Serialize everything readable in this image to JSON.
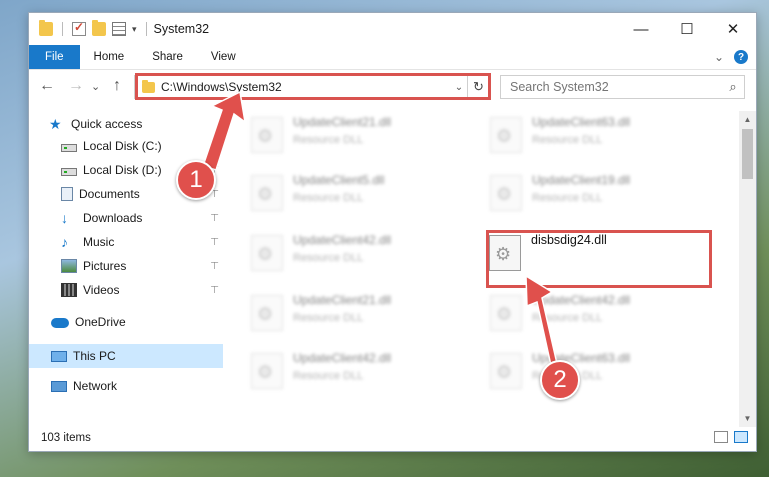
{
  "window": {
    "title": "System32",
    "controls": {
      "minimize": "—",
      "maximize": "☐",
      "close": "✕"
    }
  },
  "ribbon": {
    "tabs": [
      "File",
      "Home",
      "Share",
      "View"
    ],
    "chevron": "⌄",
    "help": "?"
  },
  "nav": {
    "back": "←",
    "forward": "→",
    "recent": "⌄",
    "up": "↑",
    "address": "C:\\Windows\\System32",
    "address_dropdown": "⌄",
    "refresh": "↻",
    "search_placeholder": "Search System32",
    "search_icon": "⌕"
  },
  "sidebar": {
    "items": [
      {
        "label": "Quick access",
        "icon": "star-icon",
        "pinned": false
      },
      {
        "label": "Local Disk (C:)",
        "icon": "disk-icon",
        "pinned": true
      },
      {
        "label": "Local Disk (D:)",
        "icon": "disk-icon",
        "pinned": true
      },
      {
        "label": "Documents",
        "icon": "documents-icon",
        "pinned": true
      },
      {
        "label": "Downloads",
        "icon": "downloads-icon",
        "pinned": true
      },
      {
        "label": "Music",
        "icon": "music-icon",
        "pinned": true
      },
      {
        "label": "Pictures",
        "icon": "pictures-icon",
        "pinned": true
      },
      {
        "label": "Videos",
        "icon": "videos-icon",
        "pinned": true
      },
      {
        "label": "OneDrive",
        "icon": "onedrive-icon",
        "pinned": false
      },
      {
        "label": "This PC",
        "icon": "this-pc-icon",
        "pinned": false,
        "selected": true
      },
      {
        "label": "Network",
        "icon": "network-icon",
        "pinned": false
      }
    ],
    "pin_glyph": "📌"
  },
  "files": {
    "left_column": [
      {
        "name": "UpdateClient21.dll",
        "type": "Resource DLL"
      },
      {
        "name": "UpdateClient5.dll",
        "type": "Resource DLL"
      },
      {
        "name": "UpdateClient42.dll",
        "type": "Resource DLL"
      },
      {
        "name": "UpdateClient21.dll",
        "type": "Resource DLL"
      },
      {
        "name": "UpdateClient42.dll",
        "type": "Resource DLL"
      }
    ],
    "right_column": [
      {
        "name": "UpdateClient63.dll",
        "type": "Resource DLL"
      },
      {
        "name": "UpdateClient19.dll",
        "type": "Resource DLL"
      },
      {
        "name": "disbsdig24.dll",
        "type": "",
        "highlighted": true
      },
      {
        "name": "UpdateClient42.dll",
        "type": "Resource DLL"
      },
      {
        "name": "UpdateClient63.dll",
        "type": "Resource DLL"
      }
    ]
  },
  "status": {
    "count": "103 items"
  },
  "annotations": {
    "step1": "1",
    "step2": "2",
    "color": "#e0504c"
  }
}
